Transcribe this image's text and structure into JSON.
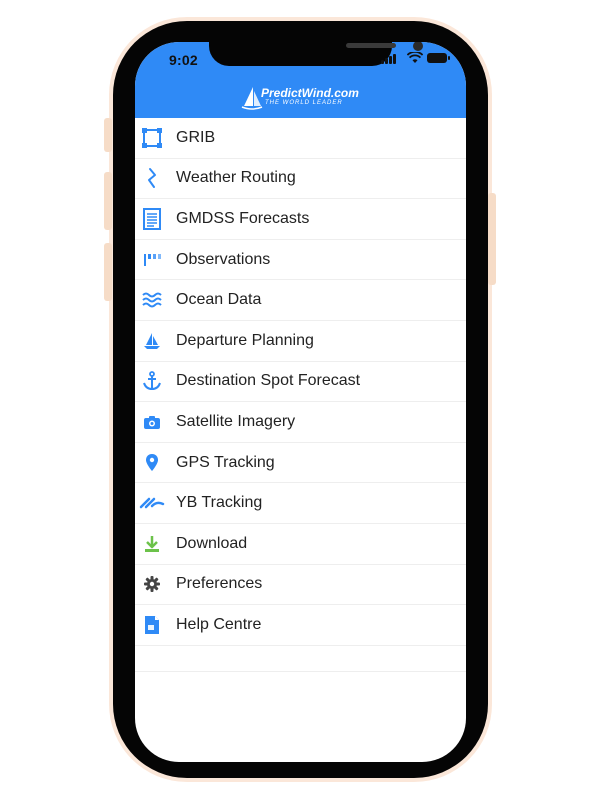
{
  "status_bar": {
    "time": "9:02"
  },
  "header": {
    "logo_text": "PredictWind.com",
    "logo_tagline": "THE WORLD LEADER",
    "background": "#2f8af6"
  },
  "colors": {
    "accent": "#2f8af6",
    "download": "#6cc24a",
    "preferences": "#444444"
  },
  "menu": {
    "items": [
      {
        "label": "GRIB",
        "icon": "grib-frame-icon"
      },
      {
        "label": "Weather Routing",
        "icon": "routing-icon"
      },
      {
        "label": "GMDSS Forecasts",
        "icon": "document-icon"
      },
      {
        "label": "Observations",
        "icon": "wind-flag-icon"
      },
      {
        "label": "Ocean Data",
        "icon": "waves-icon"
      },
      {
        "label": "Departure Planning",
        "icon": "sailboat-icon"
      },
      {
        "label": "Destination Spot Forecast",
        "icon": "anchor-icon"
      },
      {
        "label": "Satellite Imagery",
        "icon": "camera-icon"
      },
      {
        "label": "GPS Tracking",
        "icon": "map-pin-icon"
      },
      {
        "label": "YB Tracking",
        "icon": "yb-logo-icon"
      },
      {
        "label": "Download",
        "icon": "download-icon"
      },
      {
        "label": "Preferences",
        "icon": "gear-icon"
      },
      {
        "label": "Help Centre",
        "icon": "help-book-icon"
      }
    ]
  }
}
